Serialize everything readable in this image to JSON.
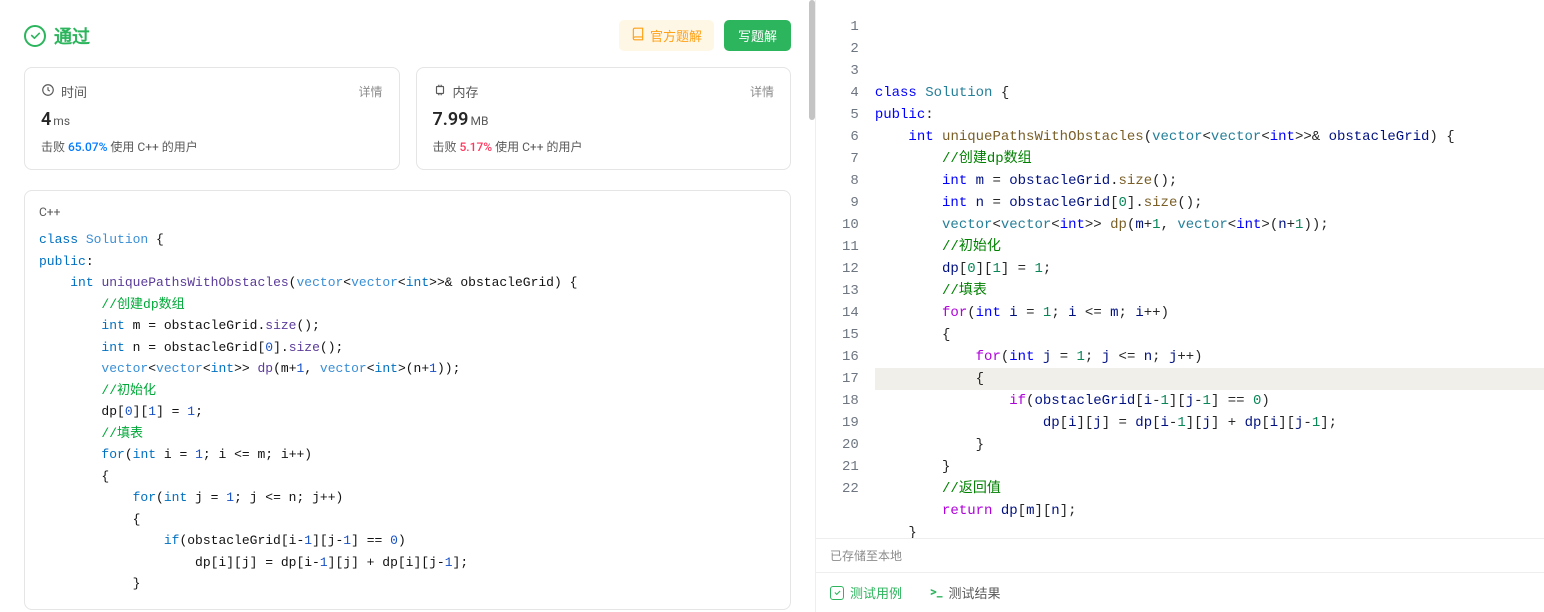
{
  "result": {
    "pass_label": "通过",
    "official_btn": "官方题解",
    "write_btn": "写题解"
  },
  "stats": {
    "time": {
      "label": "时间",
      "detail": "详情",
      "value": "4",
      "unit": "ms",
      "beat_prefix": "击败 ",
      "beat_pct": "65.07%",
      "beat_suffix": " 使用 C++ 的用户"
    },
    "memory": {
      "label": "内存",
      "detail": "详情",
      "value": "7.99",
      "unit": "MB",
      "beat_prefix": "击败 ",
      "beat_pct": "5.17%",
      "beat_suffix": " 使用 C++ 的用户"
    }
  },
  "submission": {
    "lang": "C++",
    "lines": [
      [
        [
          "sb-k",
          "class"
        ],
        [
          "sb-op",
          " "
        ],
        [
          "sb-type",
          "Solution"
        ],
        [
          "sb-op",
          " {"
        ]
      ],
      [
        [
          "sb-k",
          "public"
        ],
        [
          "sb-op",
          ":"
        ]
      ],
      [
        [
          "sb-op",
          "    "
        ],
        [
          "sb-k",
          "int"
        ],
        [
          "sb-op",
          " "
        ],
        [
          "sb-fn",
          "uniquePathsWithObstacles"
        ],
        [
          "sb-op",
          "("
        ],
        [
          "sb-type",
          "vector"
        ],
        [
          "sb-op",
          "<"
        ],
        [
          "sb-type",
          "vector"
        ],
        [
          "sb-op",
          "<"
        ],
        [
          "sb-k",
          "int"
        ],
        [
          "sb-op",
          ">>& "
        ],
        [
          "sb-name",
          "obstacleGrid"
        ],
        [
          "sb-op",
          ") {"
        ]
      ],
      [
        [
          "sb-op",
          "        "
        ],
        [
          "sb-cmt",
          "//创建dp数组"
        ]
      ],
      [
        [
          "sb-op",
          "        "
        ],
        [
          "sb-k",
          "int"
        ],
        [
          "sb-op",
          " m = obstacleGrid."
        ],
        [
          "sb-fn",
          "size"
        ],
        [
          "sb-op",
          "();"
        ]
      ],
      [
        [
          "sb-op",
          "        "
        ],
        [
          "sb-k",
          "int"
        ],
        [
          "sb-op",
          " n = obstacleGrid["
        ],
        [
          "sb-num",
          "0"
        ],
        [
          "sb-op",
          "]."
        ],
        [
          "sb-fn",
          "size"
        ],
        [
          "sb-op",
          "();"
        ]
      ],
      [
        [
          "sb-op",
          "        "
        ],
        [
          "sb-type",
          "vector"
        ],
        [
          "sb-op",
          "<"
        ],
        [
          "sb-type",
          "vector"
        ],
        [
          "sb-op",
          "<"
        ],
        [
          "sb-k",
          "int"
        ],
        [
          "sb-op",
          ">> "
        ],
        [
          "sb-fn",
          "dp"
        ],
        [
          "sb-op",
          "(m+"
        ],
        [
          "sb-num",
          "1"
        ],
        [
          "sb-op",
          ", "
        ],
        [
          "sb-type",
          "vector"
        ],
        [
          "sb-op",
          "<"
        ],
        [
          "sb-k",
          "int"
        ],
        [
          "sb-op",
          ">(n+"
        ],
        [
          "sb-num",
          "1"
        ],
        [
          "sb-op",
          "));"
        ]
      ],
      [
        [
          "sb-op",
          "        "
        ],
        [
          "sb-cmt",
          "//初始化"
        ]
      ],
      [
        [
          "sb-op",
          "        dp["
        ],
        [
          "sb-num",
          "0"
        ],
        [
          "sb-op",
          "]["
        ],
        [
          "sb-num",
          "1"
        ],
        [
          "sb-op",
          "] = "
        ],
        [
          "sb-num",
          "1"
        ],
        [
          "sb-op",
          ";"
        ]
      ],
      [
        [
          "sb-op",
          "        "
        ],
        [
          "sb-cmt",
          "//填表"
        ]
      ],
      [
        [
          "sb-op",
          "        "
        ],
        [
          "sb-k",
          "for"
        ],
        [
          "sb-op",
          "("
        ],
        [
          "sb-k",
          "int"
        ],
        [
          "sb-op",
          " i = "
        ],
        [
          "sb-num",
          "1"
        ],
        [
          "sb-op",
          "; i <= m; i++)"
        ]
      ],
      [
        [
          "sb-op",
          "        {"
        ]
      ],
      [
        [
          "sb-op",
          "            "
        ],
        [
          "sb-k",
          "for"
        ],
        [
          "sb-op",
          "("
        ],
        [
          "sb-k",
          "int"
        ],
        [
          "sb-op",
          " j = "
        ],
        [
          "sb-num",
          "1"
        ],
        [
          "sb-op",
          "; j <= n; j++)"
        ]
      ],
      [
        [
          "sb-op",
          "            {"
        ]
      ],
      [
        [
          "sb-op",
          "                "
        ],
        [
          "sb-k",
          "if"
        ],
        [
          "sb-op",
          "(obstacleGrid[i-"
        ],
        [
          "sb-num",
          "1"
        ],
        [
          "sb-op",
          "][j-"
        ],
        [
          "sb-num",
          "1"
        ],
        [
          "sb-op",
          "] == "
        ],
        [
          "sb-num",
          "0"
        ],
        [
          "sb-op",
          ")"
        ]
      ],
      [
        [
          "sb-op",
          "                    dp[i][j] = dp[i-"
        ],
        [
          "sb-num",
          "1"
        ],
        [
          "sb-op",
          "][j] + dp[i][j-"
        ],
        [
          "sb-num",
          "1"
        ],
        [
          "sb-op",
          "];"
        ]
      ],
      [
        [
          "sb-op",
          "            }"
        ]
      ]
    ]
  },
  "editor": {
    "lines": [
      [
        [
          "k-blue",
          "class"
        ],
        [
          "",
          " "
        ],
        [
          "k-type",
          "Solution"
        ],
        [
          "",
          " {"
        ]
      ],
      [
        [
          "k-blue",
          "public"
        ],
        [
          "",
          ":"
        ]
      ],
      [
        [
          "",
          "    "
        ],
        [
          "k-blue",
          "int"
        ],
        [
          "",
          " "
        ],
        [
          "k-fn",
          "uniquePathsWithObstacles"
        ],
        [
          "",
          "("
        ],
        [
          "k-type",
          "vector"
        ],
        [
          "",
          "<"
        ],
        [
          "k-type",
          "vector"
        ],
        [
          "",
          "<"
        ],
        [
          "k-blue",
          "int"
        ],
        [
          "",
          ">>& "
        ],
        [
          "k-var",
          "obstacleGrid"
        ],
        [
          "",
          ") {"
        ]
      ],
      [
        [
          "",
          "        "
        ],
        [
          "k-cmt",
          "//创建dp数组"
        ]
      ],
      [
        [
          "",
          "        "
        ],
        [
          "k-blue",
          "int"
        ],
        [
          "",
          " "
        ],
        [
          "k-var",
          "m"
        ],
        [
          "",
          " = "
        ],
        [
          "k-var",
          "obstacleGrid"
        ],
        [
          "",
          "."
        ],
        [
          "k-fn",
          "size"
        ],
        [
          "",
          "();"
        ]
      ],
      [
        [
          "",
          "        "
        ],
        [
          "k-blue",
          "int"
        ],
        [
          "",
          " "
        ],
        [
          "k-var",
          "n"
        ],
        [
          "",
          " = "
        ],
        [
          "k-var",
          "obstacleGrid"
        ],
        [
          "",
          "["
        ],
        [
          "k-num",
          "0"
        ],
        [
          "",
          "]."
        ],
        [
          "k-fn",
          "size"
        ],
        [
          "",
          "();"
        ]
      ],
      [
        [
          "",
          "        "
        ],
        [
          "k-type",
          "vector"
        ],
        [
          "",
          "<"
        ],
        [
          "k-type",
          "vector"
        ],
        [
          "",
          "<"
        ],
        [
          "k-blue",
          "int"
        ],
        [
          "",
          ">> "
        ],
        [
          "k-fn",
          "dp"
        ],
        [
          "",
          "("
        ],
        [
          "k-var",
          "m"
        ],
        [
          "",
          "+"
        ],
        [
          "k-num",
          "1"
        ],
        [
          "",
          ", "
        ],
        [
          "k-type",
          "vector"
        ],
        [
          "",
          "<"
        ],
        [
          "k-blue",
          "int"
        ],
        [
          "",
          ">("
        ],
        [
          "k-var",
          "n"
        ],
        [
          "",
          "+"
        ],
        [
          "k-num",
          "1"
        ],
        [
          "",
          "));"
        ]
      ],
      [
        [
          "",
          "        "
        ],
        [
          "k-cmt",
          "//初始化"
        ]
      ],
      [
        [
          "",
          "        "
        ],
        [
          "k-var",
          "dp"
        ],
        [
          "",
          "["
        ],
        [
          "k-num",
          "0"
        ],
        [
          "",
          "]["
        ],
        [
          "k-num",
          "1"
        ],
        [
          "",
          "] = "
        ],
        [
          "k-num",
          "1"
        ],
        [
          "",
          ";"
        ]
      ],
      [
        [
          "",
          "        "
        ],
        [
          "k-cmt",
          "//填表"
        ]
      ],
      [
        [
          "",
          "        "
        ],
        [
          "k-ctrl",
          "for"
        ],
        [
          "",
          "("
        ],
        [
          "k-blue",
          "int"
        ],
        [
          "",
          " "
        ],
        [
          "k-var",
          "i"
        ],
        [
          "",
          " = "
        ],
        [
          "k-num",
          "1"
        ],
        [
          "",
          "; "
        ],
        [
          "k-var",
          "i"
        ],
        [
          "",
          " <= "
        ],
        [
          "k-var",
          "m"
        ],
        [
          "",
          "; "
        ],
        [
          "k-var",
          "i"
        ],
        [
          "",
          "++)"
        ]
      ],
      [
        [
          "",
          "        {"
        ]
      ],
      [
        [
          "",
          "            "
        ],
        [
          "k-ctrl",
          "for"
        ],
        [
          "",
          "("
        ],
        [
          "k-blue",
          "int"
        ],
        [
          "",
          " "
        ],
        [
          "k-var",
          "j"
        ],
        [
          "",
          " = "
        ],
        [
          "k-num",
          "1"
        ],
        [
          "",
          "; "
        ],
        [
          "k-var",
          "j"
        ],
        [
          "",
          " <= "
        ],
        [
          "k-var",
          "n"
        ],
        [
          "",
          "; "
        ],
        [
          "k-var",
          "j"
        ],
        [
          "",
          "++)"
        ]
      ],
      [
        [
          "",
          "            {"
        ]
      ],
      [
        [
          "",
          "                "
        ],
        [
          "k-ctrl",
          "if"
        ],
        [
          "",
          "("
        ],
        [
          "k-var",
          "obstacleGrid"
        ],
        [
          "",
          "["
        ],
        [
          "k-var",
          "i"
        ],
        [
          "",
          "-"
        ],
        [
          "k-num",
          "1"
        ],
        [
          "",
          "]["
        ],
        [
          "k-var",
          "j"
        ],
        [
          "",
          "-"
        ],
        [
          "k-num",
          "1"
        ],
        [
          "",
          "] == "
        ],
        [
          "k-num",
          "0"
        ],
        [
          "",
          ")"
        ]
      ],
      [
        [
          "",
          "                    "
        ],
        [
          "k-var",
          "dp"
        ],
        [
          "",
          "["
        ],
        [
          "k-var",
          "i"
        ],
        [
          "",
          "]["
        ],
        [
          "k-var",
          "j"
        ],
        [
          "",
          "] = "
        ],
        [
          "k-var",
          "dp"
        ],
        [
          "",
          "["
        ],
        [
          "k-var",
          "i"
        ],
        [
          "",
          "-"
        ],
        [
          "k-num",
          "1"
        ],
        [
          "",
          "]["
        ],
        [
          "k-var",
          "j"
        ],
        [
          "",
          "] + "
        ],
        [
          "k-var",
          "dp"
        ],
        [
          "",
          "["
        ],
        [
          "k-var",
          "i"
        ],
        [
          "",
          "]["
        ],
        [
          "k-var",
          "j"
        ],
        [
          "",
          "-"
        ],
        [
          "k-num",
          "1"
        ],
        [
          "",
          "];"
        ]
      ],
      [
        [
          "",
          "            }"
        ]
      ],
      [
        [
          "",
          "        }"
        ]
      ],
      [
        [
          "",
          "        "
        ],
        [
          "k-cmt",
          "//返回值"
        ]
      ],
      [
        [
          "",
          "        "
        ],
        [
          "k-ctrl",
          "return"
        ],
        [
          "",
          " "
        ],
        [
          "k-var",
          "dp"
        ],
        [
          "",
          "["
        ],
        [
          "k-var",
          "m"
        ],
        [
          "",
          "]["
        ],
        [
          "k-var",
          "n"
        ],
        [
          "",
          "];"
        ]
      ],
      [
        [
          "",
          "    }"
        ]
      ],
      [
        [
          "",
          "};"
        ]
      ]
    ]
  },
  "status_bar": "已存储至本地",
  "tabs": {
    "testcase": "测试用例",
    "result": "测试结果"
  }
}
